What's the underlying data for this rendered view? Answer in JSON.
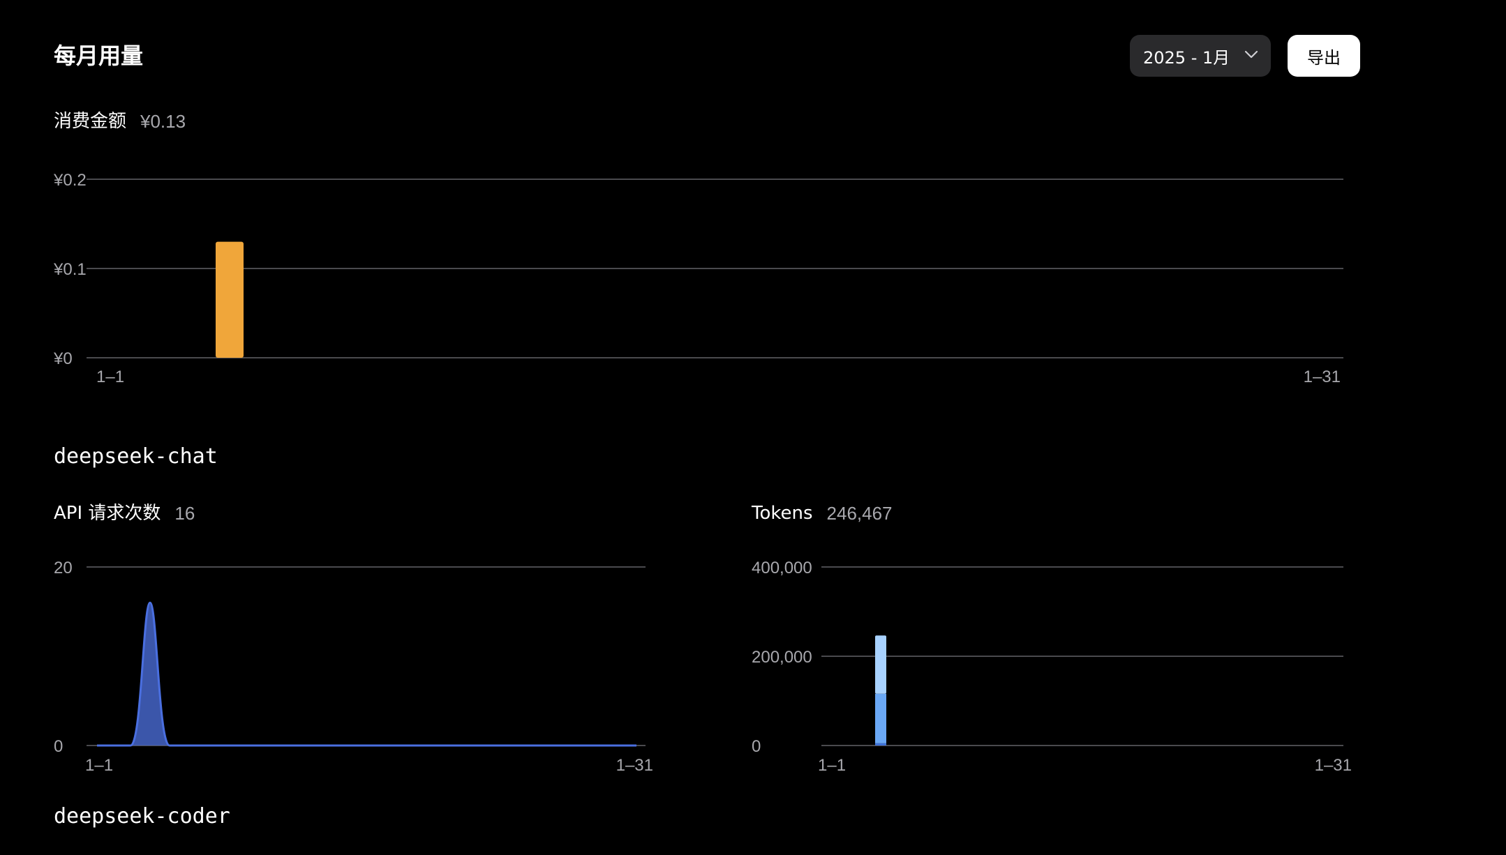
{
  "header": {
    "title": "每月用量",
    "month_select": {
      "value": "2025 - 1月"
    },
    "export_label": "导出"
  },
  "spend": {
    "label": "消费金额",
    "value": "¥0.13"
  },
  "models": [
    {
      "name": "deepseek-chat",
      "requests": {
        "label": "API 请求次数",
        "value": "16"
      },
      "tokens": {
        "label": "Tokens",
        "value": "246,467"
      }
    },
    {
      "name": "deepseek-coder"
    }
  ],
  "colors": {
    "spend_bar": "#f0a63a",
    "requests_line": "#4a6fe0",
    "requests_fill": "#4565c8",
    "tokens_light": "#a8d2ff",
    "tokens_mid": "#6aa8f5",
    "tokens_dark": "#3f72d8",
    "gridline": "#4a4a4e",
    "tick_text": "#a8a8ad"
  },
  "chart_data": [
    {
      "id": "spend",
      "type": "bar",
      "title": "消费金额",
      "x": [
        "1-1",
        "1-2",
        "1-3",
        "1-4",
        "1-5",
        "1-6",
        "1-7",
        "1-8",
        "1-9",
        "1-10",
        "1-11",
        "1-12",
        "1-13",
        "1-14",
        "1-15",
        "1-16",
        "1-17",
        "1-18",
        "1-19",
        "1-20",
        "1-21",
        "1-22",
        "1-23",
        "1-24",
        "1-25",
        "1-26",
        "1-27",
        "1-28",
        "1-29",
        "1-30",
        "1-31"
      ],
      "values": [
        0,
        0,
        0,
        0,
        0.13,
        0,
        0,
        0,
        0,
        0,
        0,
        0,
        0,
        0,
        0,
        0,
        0,
        0,
        0,
        0,
        0,
        0,
        0,
        0,
        0,
        0,
        0,
        0,
        0,
        0,
        0
      ],
      "ylim": [
        0,
        0.2
      ],
      "y_ticks": [
        "¥0",
        "¥0.1",
        "¥0.2"
      ],
      "x_tick_labels": [
        "1–1",
        "1–31"
      ],
      "grid": true
    },
    {
      "id": "requests",
      "type": "area",
      "title": "API 请求次数",
      "x": [
        "1-1",
        "1-2",
        "1-3",
        "1-4",
        "1-5",
        "1-6",
        "1-7",
        "1-8",
        "1-9",
        "1-10",
        "1-11",
        "1-12",
        "1-13",
        "1-14",
        "1-15",
        "1-16",
        "1-17",
        "1-18",
        "1-19",
        "1-20",
        "1-21",
        "1-22",
        "1-23",
        "1-24",
        "1-25",
        "1-26",
        "1-27",
        "1-28",
        "1-29",
        "1-30",
        "1-31"
      ],
      "values": [
        0,
        0,
        0,
        16,
        0,
        0,
        0,
        0,
        0,
        0,
        0,
        0,
        0,
        0,
        0,
        0,
        0,
        0,
        0,
        0,
        0,
        0,
        0,
        0,
        0,
        0,
        0,
        0,
        0,
        0,
        0
      ],
      "ylim": [
        0,
        20
      ],
      "y_ticks": [
        "0",
        "20"
      ],
      "x_tick_labels": [
        "1–1",
        "1–31"
      ],
      "grid": true
    },
    {
      "id": "tokens",
      "type": "bar",
      "title": "Tokens",
      "stacked": true,
      "x": [
        "1-1",
        "1-2",
        "1-3",
        "1-4",
        "1-5",
        "1-6",
        "1-7",
        "1-8",
        "1-9",
        "1-10",
        "1-11",
        "1-12",
        "1-13",
        "1-14",
        "1-15",
        "1-16",
        "1-17",
        "1-18",
        "1-19",
        "1-20",
        "1-21",
        "1-22",
        "1-23",
        "1-24",
        "1-25",
        "1-26",
        "1-27",
        "1-28",
        "1-29",
        "1-30",
        "1-31"
      ],
      "series": [
        {
          "values": [
            0,
            0,
            0,
            0,
            5000,
            0,
            0,
            0,
            0,
            0,
            0,
            0,
            0,
            0,
            0,
            0,
            0,
            0,
            0,
            0,
            0,
            0,
            0,
            0,
            0,
            0,
            0,
            0,
            0,
            0,
            0
          ]
        },
        {
          "values": [
            0,
            0,
            0,
            0,
            111000,
            0,
            0,
            0,
            0,
            0,
            0,
            0,
            0,
            0,
            0,
            0,
            0,
            0,
            0,
            0,
            0,
            0,
            0,
            0,
            0,
            0,
            0,
            0,
            0,
            0,
            0
          ]
        },
        {
          "values": [
            0,
            0,
            0,
            0,
            130467,
            0,
            0,
            0,
            0,
            0,
            0,
            0,
            0,
            0,
            0,
            0,
            0,
            0,
            0,
            0,
            0,
            0,
            0,
            0,
            0,
            0,
            0,
            0,
            0,
            0,
            0
          ]
        }
      ],
      "ylim": [
        0,
        400000
      ],
      "y_ticks": [
        "0",
        "200,000",
        "400,000"
      ],
      "x_tick_labels": [
        "1–1",
        "1–31"
      ],
      "grid": true
    }
  ]
}
